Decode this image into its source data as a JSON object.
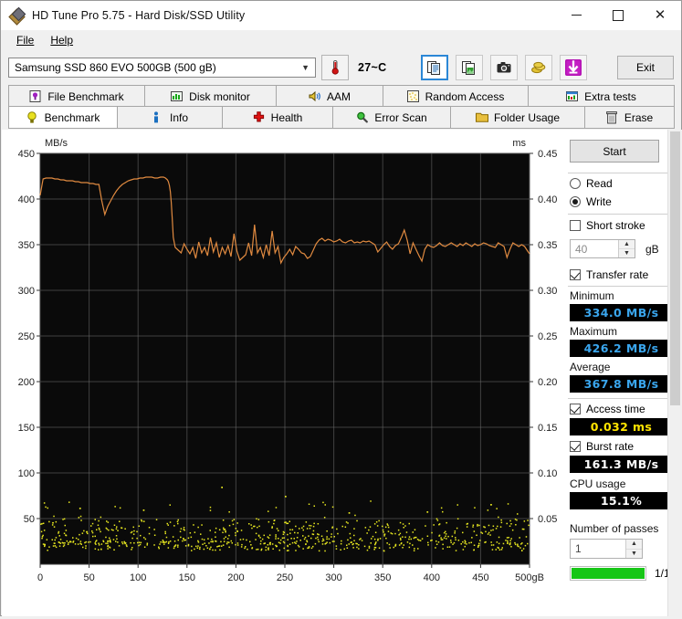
{
  "window": {
    "title": "HD Tune Pro 5.75 - Hard Disk/SSD Utility",
    "minimize": "—",
    "maximize": "□",
    "close": "✕"
  },
  "menu": {
    "items": [
      "File",
      "Help"
    ]
  },
  "toolbar": {
    "drive_value": "Samsung SSD 860 EVO 500GB (500 gB)",
    "chevron": "⌄",
    "temperature": "27~C",
    "icons": [
      "copy-text-icon",
      "copy-image-icon",
      "screenshot-camera-icon",
      "coins-icon",
      "download-arrow-icon"
    ],
    "exit_label": "Exit"
  },
  "tabs": {
    "row1": [
      {
        "label": "File Benchmark",
        "icon": "file-benchmark-icon",
        "active": false
      },
      {
        "label": "Disk monitor",
        "icon": "disk-monitor-icon",
        "active": false
      },
      {
        "label": "AAM",
        "icon": "aam-speaker-icon",
        "active": false
      },
      {
        "label": "Random Access",
        "icon": "random-access-icon",
        "active": false
      },
      {
        "label": "Extra tests",
        "icon": "extra-tests-icon",
        "active": false
      }
    ],
    "row2": [
      {
        "label": "Benchmark",
        "icon": "benchmark-bulb-icon",
        "active": true
      },
      {
        "label": "Info",
        "icon": "info-icon",
        "active": false
      },
      {
        "label": "Health",
        "icon": "health-cross-icon",
        "active": false
      },
      {
        "label": "Error Scan",
        "icon": "error-scan-magnifier-icon",
        "active": false
      },
      {
        "label": "Folder Usage",
        "icon": "folder-usage-icon",
        "active": false
      },
      {
        "label": "Erase",
        "icon": "erase-trash-icon",
        "active": false
      }
    ]
  },
  "panel": {
    "start_label": "Start",
    "mode": {
      "read_label": "Read",
      "write_label": "Write",
      "selected": "Write"
    },
    "short_stroke": {
      "label": "Short stroke",
      "checked": false,
      "value": "40",
      "unit": "gB"
    },
    "transfer_rate": {
      "label": "Transfer rate",
      "checked": true
    },
    "minimum": {
      "label": "Minimum",
      "value": "334.0 MB/s"
    },
    "maximum": {
      "label": "Maximum",
      "value": "426.2 MB/s"
    },
    "average": {
      "label": "Average",
      "value": "367.8 MB/s"
    },
    "access_time": {
      "label": "Access time",
      "checked": true,
      "value": "0.032 ms"
    },
    "burst_rate": {
      "label": "Burst rate",
      "checked": true,
      "value": "161.3 MB/s"
    },
    "cpu_usage": {
      "label": "CPU usage",
      "value": "15.1%"
    },
    "passes": {
      "label": "Number of passes",
      "value": "1",
      "progress_text": "1/1",
      "progress_pct": 100
    }
  },
  "chart_data": {
    "type": "line",
    "title": "",
    "xlabel": "gB",
    "ylabel": "MB/s",
    "y2label": "ms",
    "xlim": [
      0,
      500
    ],
    "ylim": [
      0,
      450
    ],
    "y2lim": [
      0,
      0.45
    ],
    "grid": true,
    "xticks": [
      0,
      50,
      100,
      150,
      200,
      250,
      300,
      350,
      400,
      450,
      500
    ],
    "yticks": [
      50,
      100,
      150,
      200,
      250,
      300,
      350,
      400,
      450
    ],
    "y2ticks": [
      0.05,
      0.1,
      0.15,
      0.2,
      0.25,
      0.3,
      0.35,
      0.4,
      0.45
    ],
    "plot_bg": "#0a0a0a",
    "grid_color": "#6d6d6d",
    "series": [
      {
        "name": "Transfer rate",
        "color": "#e08a40",
        "unit": "MB/s",
        "axis": "left",
        "x": [
          0,
          3,
          6,
          9,
          12,
          15,
          18,
          21,
          24,
          27,
          30,
          33,
          36,
          39,
          42,
          45,
          48,
          51,
          54,
          57,
          60,
          63,
          66,
          69,
          72,
          75,
          78,
          81,
          84,
          87,
          90,
          93,
          96,
          99,
          102,
          105,
          108,
          111,
          114,
          117,
          120,
          123,
          126,
          128,
          130,
          131,
          132,
          133,
          134,
          135,
          136,
          138,
          141,
          144,
          147,
          150,
          153,
          156,
          159,
          162,
          165,
          168,
          171,
          174,
          177,
          180,
          183,
          186,
          189,
          192,
          195,
          198,
          201,
          204,
          207,
          210,
          213,
          216,
          219,
          222,
          225,
          228,
          231,
          234,
          237,
          240,
          243,
          246,
          249,
          252,
          255,
          258,
          261,
          264,
          267,
          270,
          273,
          276,
          279,
          282,
          285,
          288,
          291,
          294,
          297,
          300,
          303,
          306,
          309,
          312,
          315,
          318,
          321,
          324,
          327,
          330,
          333,
          336,
          339,
          342,
          345,
          348,
          351,
          354,
          357,
          360,
          363,
          366,
          369,
          372,
          375,
          378,
          381,
          384,
          387,
          390,
          393,
          396,
          399,
          402,
          405,
          408,
          411,
          414,
          417,
          420,
          423,
          426,
          429,
          432,
          435,
          438,
          441,
          444,
          447,
          450,
          453,
          456,
          459,
          462,
          465,
          468,
          471,
          474,
          477,
          480,
          483,
          486,
          489,
          492,
          495,
          498,
          500
        ],
        "y": [
          404,
          422,
          423,
          423,
          423,
          422,
          422,
          421,
          421,
          420,
          420,
          420,
          419,
          419,
          418,
          418,
          418,
          417,
          417,
          416,
          416,
          398,
          383,
          392,
          398,
          404,
          409,
          413,
          416,
          418,
          420,
          421,
          422,
          422,
          423,
          423,
          424,
          424,
          424,
          423,
          423,
          424,
          424,
          423,
          421,
          419,
          415,
          408,
          396,
          378,
          358,
          347,
          344,
          341,
          351,
          345,
          340,
          347,
          335,
          353,
          341,
          347,
          338,
          358,
          342,
          352,
          336,
          347,
          340,
          349,
          337,
          362,
          343,
          333,
          336,
          339,
          352,
          338,
          372,
          341,
          347,
          336,
          350,
          338,
          365,
          341,
          348,
          330,
          336,
          340,
          345,
          339,
          348,
          345,
          341,
          340,
          335,
          337,
          344,
          351,
          355,
          357,
          354,
          356,
          355,
          353,
          354,
          356,
          353,
          352,
          354,
          355,
          352,
          353,
          352,
          354,
          353,
          354,
          352,
          350,
          342,
          346,
          350,
          353,
          348,
          345,
          349,
          351,
          358,
          366,
          355,
          340,
          352,
          345,
          338,
          332,
          345,
          350,
          348,
          347,
          349,
          352,
          349,
          348,
          350,
          352,
          350,
          348,
          351,
          349,
          352,
          350,
          348,
          351,
          349,
          350,
          352,
          351,
          349,
          348,
          347,
          352,
          350,
          348,
          336,
          345,
          352,
          350,
          348,
          350,
          348,
          343,
          340
        ]
      },
      {
        "name": "Access time",
        "color": "#e8e820",
        "unit": "ms",
        "axis": "right",
        "type": "scatter",
        "mean": 0.032,
        "spread": [
          0.015,
          0.055
        ],
        "outliers": [
          0.085,
          0.062,
          0.058,
          0.075,
          0.06,
          0.066,
          0.057
        ]
      }
    ]
  }
}
